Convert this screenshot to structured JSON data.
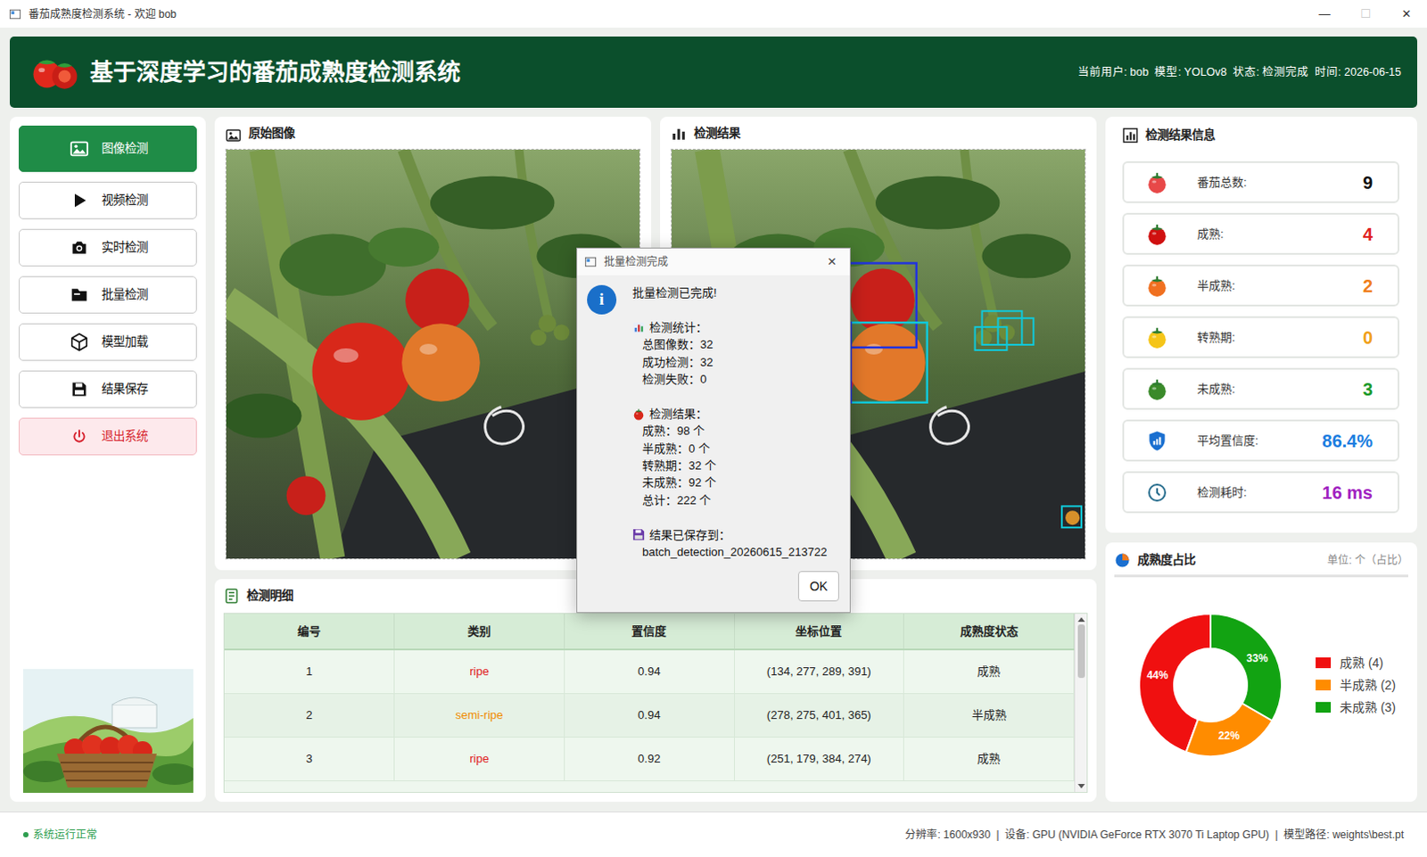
{
  "window": {
    "title": "番茄成熟度检测系统 - 欢迎 bob",
    "controls": [
      {
        "glyph": "—",
        "disabled": false
      },
      {
        "glyph": "☐",
        "disabled": true
      },
      {
        "glyph": "✕",
        "disabled": false
      }
    ]
  },
  "header": {
    "title": "基于深度学习的番茄成熟度检测系统",
    "info": "当前用户: bob  模型: YOLOv8  状态: 检测完成  时间: 2026-06-15"
  },
  "sidebar": {
    "items": [
      {
        "label": "图像检测",
        "selected": true,
        "kind": "normal"
      },
      {
        "label": "视频检测",
        "selected": false,
        "kind": "normal"
      },
      {
        "label": "实时检测",
        "selected": false,
        "kind": "normal"
      },
      {
        "label": "批量检测",
        "selected": false,
        "kind": "normal"
      },
      {
        "label": "模型加载",
        "selected": false,
        "kind": "normal"
      },
      {
        "label": "结果保存",
        "selected": false,
        "kind": "normal"
      },
      {
        "label": "退出系统",
        "selected": false,
        "kind": "danger"
      }
    ]
  },
  "panels": {
    "original": {
      "title": "原始图像"
    },
    "result": {
      "title": "检测结果"
    }
  },
  "table": {
    "title": "检测明细",
    "columns": [
      "编号",
      "类别",
      "置信度",
      "坐标位置",
      "成熟度状态"
    ],
    "rows": [
      {
        "cells": [
          "1",
          "ripe",
          "0.94",
          "(134, 277, 289, 391)",
          "成熟"
        ],
        "color": "#e02020"
      },
      {
        "cells": [
          "2",
          "semi-ripe",
          "0.94",
          "(278, 275, 401, 365)",
          "半成熟"
        ],
        "color": "#f08c00"
      },
      {
        "cells": [
          "3",
          "ripe",
          "0.92",
          "(251, 179, 384, 274)",
          "成熟"
        ],
        "color": "#e02020"
      }
    ]
  },
  "info": {
    "title": "检测结果信息",
    "stats": [
      {
        "label": "番茄总数:",
        "value": "9",
        "color": "#111111"
      },
      {
        "label": "成熟:",
        "value": "4",
        "color": "#e02020"
      },
      {
        "label": "半成熟:",
        "value": "2",
        "color": "#f07e1a"
      },
      {
        "label": "转熟期:",
        "value": "0",
        "color": "#f0a01a"
      },
      {
        "label": "未成熟:",
        "value": "3",
        "color": "#1a9a2a"
      },
      {
        "label": "平均置信度:",
        "value": "86.4%",
        "color": "#1a7de0"
      },
      {
        "label": "检测耗时:",
        "value": "16 ms",
        "color": "#a020c0"
      }
    ]
  },
  "chart": {
    "title": "成熟度占比",
    "unit": "单位: 个（占比）",
    "series": [
      {
        "value": 4,
        "percent": "44%",
        "legend": "成熟 (4)",
        "color": "#f01010"
      },
      {
        "value": 2,
        "percent": "22%",
        "legend": "半成熟 (2)",
        "color": "#ff8c00"
      },
      {
        "value": 3,
        "percent": "33%",
        "legend": "未成熟 (3)",
        "color": "#12a312"
      }
    ]
  },
  "status_bar": {
    "status": "系统运行正常",
    "info": "分辨率: 1600x930  |  设备: GPU (NVIDIA GeForce RTX 3070 Ti Laptop GPU)  |  模型路径: weights\\best.pt"
  },
  "dialog": {
    "title": "批量检测完成",
    "close": "×",
    "icon": "i",
    "message": "批量检测已完成!",
    "sections": [
      {
        "kind": "stats",
        "heading": "检测统计：",
        "lines": [
          "总图像数：32",
          "成功检测：32",
          "检测失败：0"
        ]
      },
      {
        "kind": "tomato",
        "heading": "检测结果：",
        "lines": [
          "成熟：98 个",
          "半成熟：0 个",
          "转熟期：32 个",
          "未成熟：92 个",
          "总计：222 个"
        ]
      },
      {
        "kind": "save",
        "heading": "结果已保存到：",
        "lines": [
          "batch_detection_20260615_213722"
        ]
      }
    ],
    "buttons": [
      "OK"
    ]
  }
}
